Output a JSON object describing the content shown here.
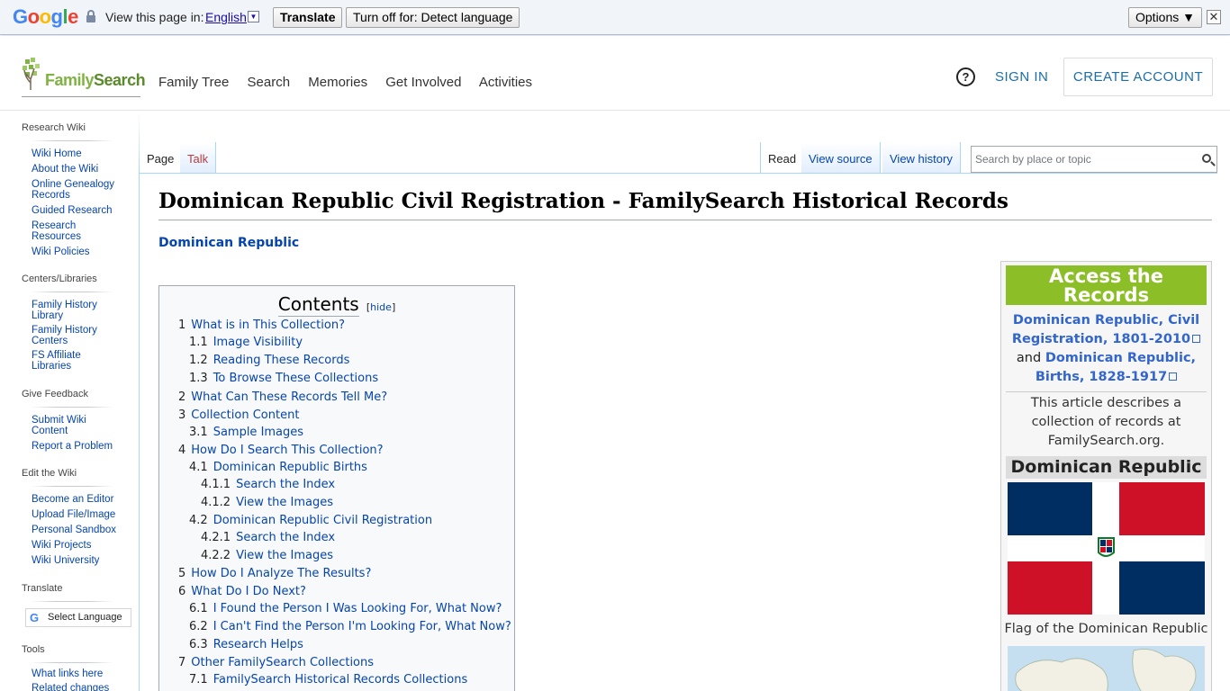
{
  "translate_bar": {
    "logo_letters": [
      "G",
      "o",
      "o",
      "g",
      "l",
      "e"
    ],
    "logo_colors": [
      "#4285f4",
      "#ea4335",
      "#fbbc05",
      "#4285f4",
      "#34a853",
      "#ea4335"
    ],
    "view_label": "View this page in:",
    "language": "English",
    "translate_button": "Translate",
    "turn_off_button": "Turn off for: Detect language",
    "options_button": "Options ▼",
    "close_glyph": "✕"
  },
  "header": {
    "logo_text_a": "Family",
    "logo_text_b": "Search",
    "nav": [
      "Family Tree",
      "Search",
      "Memories",
      "Get Involved",
      "Activities"
    ],
    "help_glyph": "?",
    "sign_in": "SIGN IN",
    "create_account": "CREATE ACCOUNT"
  },
  "sidebar": {
    "sections": [
      {
        "title": "Research Wiki",
        "links": [
          "Wiki Home",
          "About the Wiki",
          "Online Genealogy Records",
          "Guided Research",
          "Research Resources",
          "Wiki Policies"
        ]
      },
      {
        "title": "Centers/Libraries",
        "links": [
          "Family History Library",
          "Family History Centers",
          "FS Affiliate Libraries"
        ]
      },
      {
        "title": "Give Feedback",
        "links": [
          "Submit Wiki Content",
          "Report a Problem"
        ]
      },
      {
        "title": "Edit the Wiki",
        "links": [
          "Become an Editor",
          "Upload File/Image",
          "Personal Sandbox",
          "Wiki Projects",
          "Wiki University"
        ]
      },
      {
        "title": "Translate",
        "links": []
      },
      {
        "title": "Tools",
        "links": [
          "What links here",
          "Related changes"
        ]
      }
    ],
    "select_language": "Select Language",
    "g_glyph": "G"
  },
  "tabs": {
    "page": "Page",
    "talk": "Talk",
    "read": "Read",
    "view_source": "View source",
    "view_history": "View history",
    "search_placeholder": "Search by place or topic"
  },
  "article": {
    "title": "Dominican Republic Civil Registration - FamilySearch Historical Records",
    "breadcrumb": "Dominican Republic"
  },
  "toc": {
    "title": "Contents",
    "hide_open": "[",
    "hide": "hide",
    "hide_close": "]",
    "items": [
      {
        "num": "1",
        "text": "What is in This Collection?",
        "level": 1
      },
      {
        "num": "1.1",
        "text": "Image Visibility",
        "level": 2
      },
      {
        "num": "1.2",
        "text": "Reading These Records",
        "level": 2
      },
      {
        "num": "1.3",
        "text": "To Browse These Collections",
        "level": 2
      },
      {
        "num": "2",
        "text": "What Can These Records Tell Me?",
        "level": 1
      },
      {
        "num": "3",
        "text": "Collection Content",
        "level": 1
      },
      {
        "num": "3.1",
        "text": "Sample Images",
        "level": 2
      },
      {
        "num": "4",
        "text": "How Do I Search This Collection?",
        "level": 1
      },
      {
        "num": "4.1",
        "text": "Dominican Republic Births",
        "level": 2
      },
      {
        "num": "4.1.1",
        "text": "Search the Index",
        "level": 3
      },
      {
        "num": "4.1.2",
        "text": "View the Images",
        "level": 3
      },
      {
        "num": "4.2",
        "text": "Dominican Republic Civil Registration",
        "level": 2
      },
      {
        "num": "4.2.1",
        "text": "Search the Index",
        "level": 3
      },
      {
        "num": "4.2.2",
        "text": "View the Images",
        "level": 3
      },
      {
        "num": "5",
        "text": "How Do I Analyze The Results?",
        "level": 1
      },
      {
        "num": "6",
        "text": "What Do I Do Next?",
        "level": 1
      },
      {
        "num": "6.1",
        "text": "I Found the Person I Was Looking For, What Now?",
        "level": 2
      },
      {
        "num": "6.2",
        "text": "I Can't Find the Person I'm Looking For, What Now?",
        "level": 2
      },
      {
        "num": "6.3",
        "text": "Research Helps",
        "level": 2
      },
      {
        "num": "7",
        "text": "Other FamilySearch Collections",
        "level": 1
      },
      {
        "num": "7.1",
        "text": "FamilySearch Historical Records Collections",
        "level": 2
      }
    ]
  },
  "infobox": {
    "access_line1": "Access the",
    "access_line2": "Records",
    "link1_line1": "Dominican Republic, Civil",
    "link1_line2": "Registration, 1801-2010",
    "and": "and",
    "link2_line1": "Dominican Republic,",
    "link2_line2": "Births, 1828-1917",
    "desc_line1": "This article describes a",
    "desc_line2": "collection of records at",
    "desc_line3": "FamilySearch.org.",
    "country": "Dominican Republic",
    "flag_caption": "Flag of the Dominican Republic",
    "colors": {
      "accent_green": "#8cbf27",
      "flag_blue": "#002d62",
      "flag_red": "#ce1126"
    }
  }
}
